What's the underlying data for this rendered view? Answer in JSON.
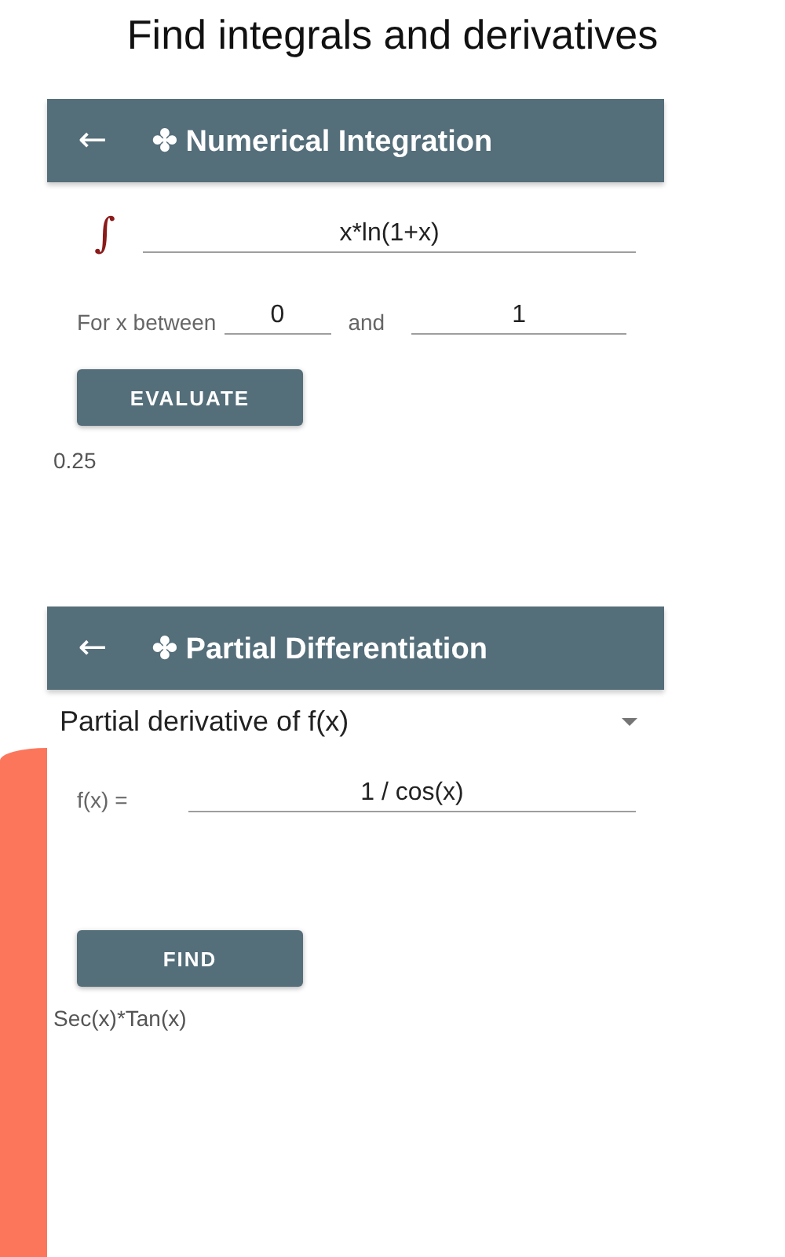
{
  "headline": "Find integrals and derivatives",
  "integration": {
    "back": "←",
    "title": "✤ Numerical Integration",
    "symbol": "∫",
    "expression": "x*ln(1+x)",
    "range_label": "For x between",
    "lower": "0",
    "and_label": "and",
    "upper": "1",
    "button": "EVALUATE",
    "result": "0.25"
  },
  "differentiation": {
    "back": "←",
    "title": "✤ Partial Differentiation",
    "mode": "Partial derivative of f(x)",
    "function_label": "f(x) =",
    "expression": "1 / cos(x)",
    "button": "FIND",
    "result": "Sec(x)*Tan(x)"
  }
}
